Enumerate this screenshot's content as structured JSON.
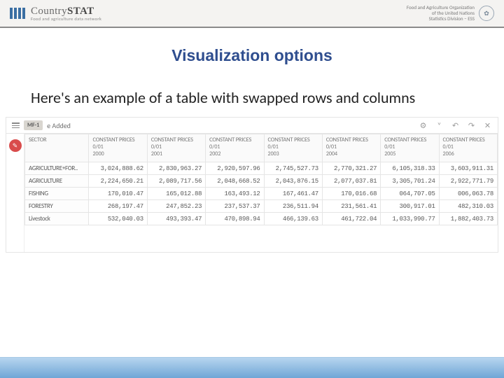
{
  "header": {
    "logo_text": "Country",
    "logo_bold": "STAT",
    "logo_sub": "Food and agriculture data network",
    "fao_line1": "Food and Agriculture Organization",
    "fao_line2": "of the United Nations",
    "fao_line3": "Statistics Division – ESS"
  },
  "title": "Visualization options",
  "subtext": "Here's an example of a table with swapped rows and columns",
  "panel": {
    "badge": "MF-1",
    "tab_label": "e Added",
    "icons": {
      "gear": "⚙",
      "chev": "˅",
      "back": "↶",
      "fwd": "↷",
      "close": "✕"
    }
  },
  "chart_data": {
    "type": "table",
    "row_header": "SECTOR",
    "col_header_line1": "CONSTANT PRICES",
    "col_header_line2": "0/01",
    "years": [
      "2000",
      "2001",
      "2002",
      "2003",
      "2004",
      "2005",
      "2006"
    ],
    "rows": [
      {
        "name": "AGRICULTURE+FOR..",
        "vals": [
          "3,024,888.62",
          "2,830,963.27",
          "2,920,597.96",
          "2,745,527.73",
          "2,770,321.27",
          "6,105,318.33",
          "3,603,911.31"
        ]
      },
      {
        "name": "AGRICULTURE",
        "vals": [
          "2,224,650.21",
          "2,089,717.56",
          "2,048,668.52",
          "2,043,876.15",
          "2,077,037.81",
          "3,305,701.24",
          "2,922,771.79"
        ]
      },
      {
        "name": "FISHING",
        "vals": [
          "170,010.47",
          "165,012.88",
          "163,493.12",
          "167,461.47",
          "170,016.68",
          "064,707.05",
          "006,063.78"
        ]
      },
      {
        "name": "FORESTRY",
        "vals": [
          "268,197.47",
          "247,852.23",
          "237,537.37",
          "236,511.94",
          "231,561.41",
          "300,917.01",
          "482,310.03"
        ]
      },
      {
        "name": "Livestock",
        "vals": [
          "532,040.03",
          "493,393.47",
          "470,898.94",
          "466,139.63",
          "461,722.04",
          "1,033,990.77",
          "1,882,403.73"
        ]
      }
    ]
  }
}
